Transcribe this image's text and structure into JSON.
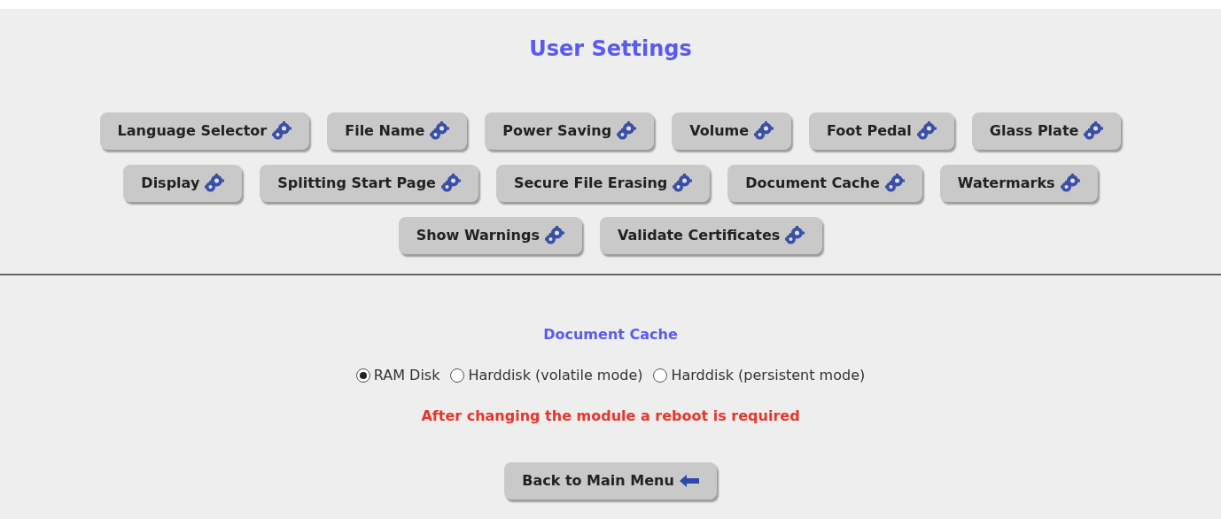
{
  "title": "User Settings",
  "setting_button_rows": [
    [
      "Language Selector",
      "File Name",
      "Power Saving",
      "Volume",
      "Foot Pedal",
      "Glass Plate"
    ],
    [
      "Display",
      "Splitting Start Page",
      "Secure File Erasing",
      "Document Cache",
      "Watermarks"
    ],
    [
      "Show Warnings",
      "Validate Certificates"
    ]
  ],
  "section": {
    "title": "Document Cache",
    "options": [
      {
        "label": "RAM Disk",
        "selected": true
      },
      {
        "label": "Harddisk (volatile mode)",
        "selected": false
      },
      {
        "label": "Harddisk (persistent mode)",
        "selected": false
      }
    ],
    "warning": "After changing the module a reboot is required"
  },
  "back_button": "Back to Main Menu"
}
